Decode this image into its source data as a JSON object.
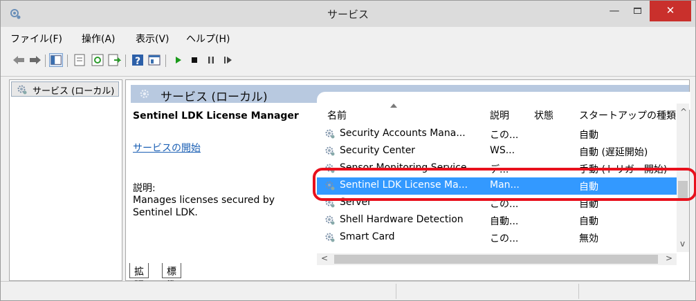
{
  "window": {
    "title": "サービス",
    "close_symbol": "✕",
    "minimize_symbol": "—"
  },
  "menu": [
    "ファイル(F)",
    "操作(A)",
    "表示(V)",
    "ヘルプ(H)"
  ],
  "toolbar_icons": [
    "back-arrow-icon",
    "forward-arrow-icon",
    "show-hide-tree-icon",
    "properties-icon",
    "refresh-icon",
    "export-list-icon",
    "help-icon",
    "view-icon",
    "start-icon",
    "stop-icon",
    "pause-icon",
    "restart-icon"
  ],
  "tree": {
    "root_label": "サービス (ローカル)"
  },
  "header": {
    "title": "サービス (ローカル)"
  },
  "details": {
    "service_name": "Sentinel LDK License Manager",
    "start_link": "サービスの開始",
    "description_label": "説明:",
    "description_text": "Manages licenses secured by Sentinel LDK."
  },
  "columns": {
    "name": "名前",
    "description": "説明",
    "status": "状態",
    "startup": "スタートアップの種類"
  },
  "rows": [
    {
      "name": "Security Accounts Mana...",
      "description": "この...",
      "status": "",
      "startup": "自動"
    },
    {
      "name": "Security Center",
      "description": "WS...",
      "status": "",
      "startup": "自動 (遅延開始)"
    },
    {
      "name": "Sensor Monitoring Service",
      "description": "デ...",
      "status": "",
      "startup": "手動 (トリガー開始)"
    },
    {
      "name": "Sentinel LDK License Ma...",
      "description": "Man...",
      "status": "",
      "startup": "自動"
    },
    {
      "name": "Server",
      "description": "この...",
      "status": "",
      "startup": "自動"
    },
    {
      "name": "Shell Hardware Detection",
      "description": "自動...",
      "status": "",
      "startup": "自動"
    },
    {
      "name": "Smart Card",
      "description": "この...",
      "status": "",
      "startup": "無効"
    }
  ],
  "selected_row": 3,
  "tabs": [
    "拡張",
    "標準"
  ],
  "scroll_arrows": {
    "up": "^",
    "down": "v",
    "left": "<",
    "right": ">"
  },
  "colors": {
    "selection": "#3399ff",
    "header_band": "#b8c9e0",
    "highlight": "#e8101c",
    "link": "#1a5fb4",
    "close_button": "#c9302c"
  }
}
